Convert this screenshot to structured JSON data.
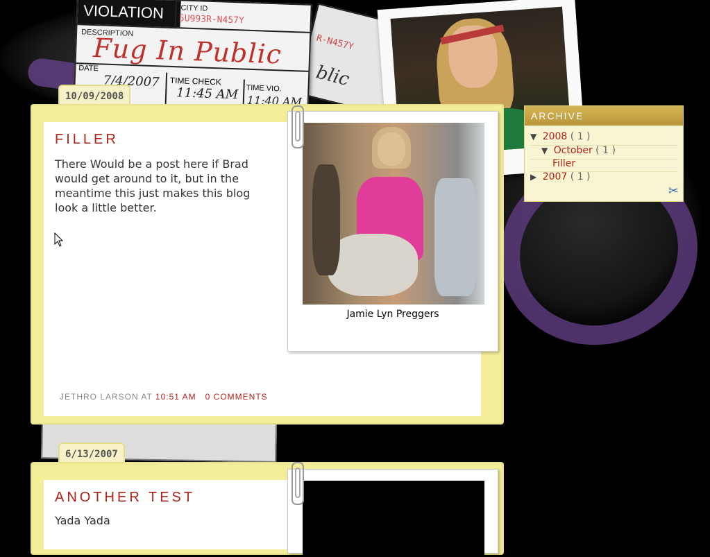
{
  "header_art": {
    "ticket": {
      "violation": "VIOLATION",
      "city_id_label": "CITY ID",
      "city_id": "5U993R-N457Y",
      "description_label": "DESCRIPTION",
      "description": "Fug In Public",
      "date_label": "DATE",
      "date": "7/4/2007",
      "time_check_label": "TIME CHECK",
      "time_check": "11:45 AM",
      "time_vio_label": "TIME VIO.",
      "time_vio": "11:40 AM"
    },
    "ticket2": {
      "city_id": "R-N457Y",
      "script": "blic"
    }
  },
  "posts": [
    {
      "date": "10/09/2008",
      "title": "FILLER",
      "body": "There Would be a post here if Brad would get around to it, but in the meantime this just makes this blog look a little better.",
      "photo_caption": "Jamie Lyn Preggers",
      "author": "JETHRO LARSON",
      "at": "AT",
      "time": "10:51 AM",
      "comments": "0 COMMENTS"
    },
    {
      "date": "6/13/2007",
      "title": "ANOTHER TEST",
      "body": "Yada Yada"
    }
  ],
  "archive": {
    "title": "ARCHIVE",
    "rows": [
      {
        "toggle": "▼",
        "label": "2008",
        "count": "( 1 )"
      },
      {
        "toggle": "▼",
        "label": "October",
        "count": "( 1 )"
      },
      {
        "label": "Filler"
      },
      {
        "toggle": "▶",
        "label": "2007",
        "count": "( 1 )"
      }
    ]
  },
  "colors": {
    "accent_red": "#b32218",
    "folder_yellow": "#f4ee9a",
    "archive_gold": "#c7a448"
  }
}
